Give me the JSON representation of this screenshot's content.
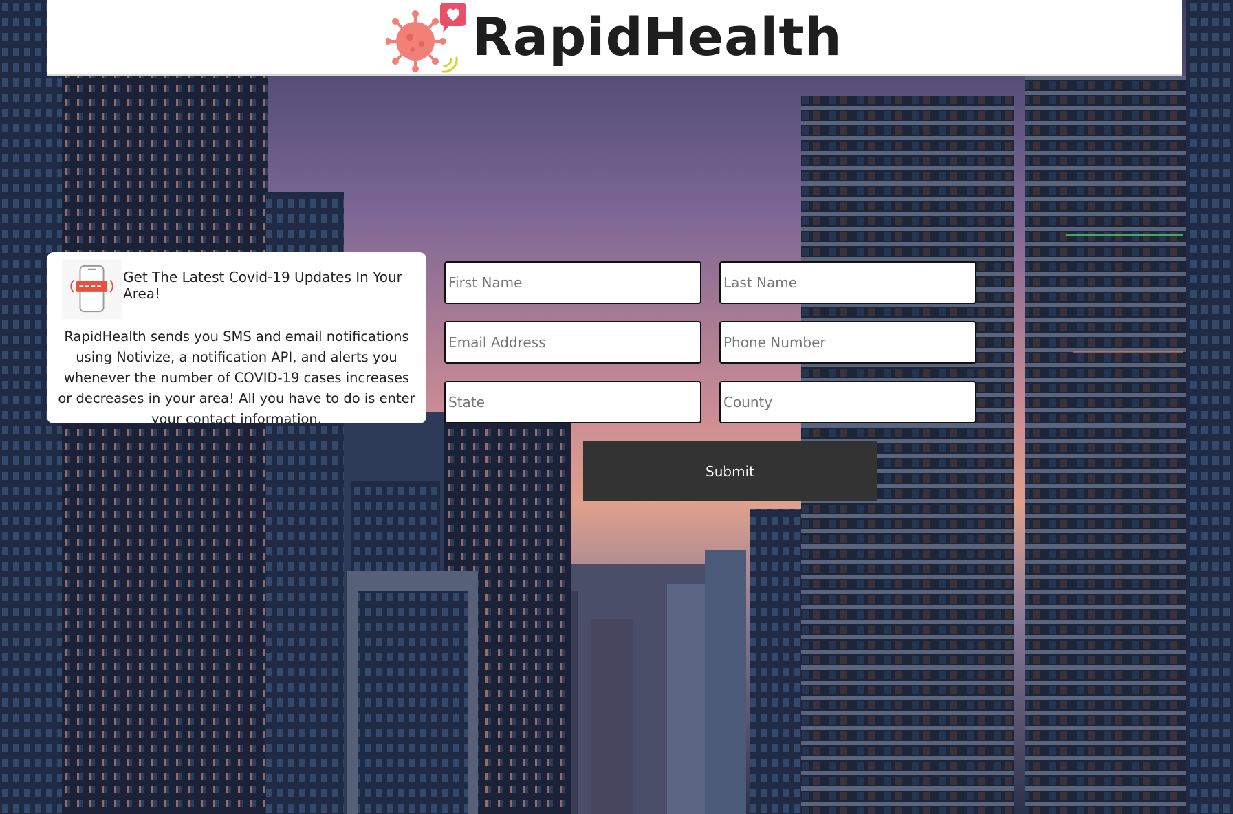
{
  "header": {
    "brand_name": "RapidHealth"
  },
  "info_card": {
    "title": "Get The Latest Covid-19 Updates In Your Area!",
    "description": "RapidHealth sends you SMS and email notifications using Notivize, a notification API, and alerts you whenever the number of COVID-19 cases increases or decreases in your area! All you have to do is enter your contact information."
  },
  "form": {
    "first_name": {
      "placeholder": "First Name",
      "value": ""
    },
    "last_name": {
      "placeholder": "Last Name",
      "value": ""
    },
    "email": {
      "placeholder": "Email Address",
      "value": ""
    },
    "phone": {
      "placeholder": "Phone Number",
      "value": ""
    },
    "state": {
      "placeholder": "State",
      "value": ""
    },
    "county": {
      "placeholder": "County",
      "value": ""
    },
    "submit_label": "Submit"
  },
  "icons": {
    "logo": "virus-notification-logo-icon",
    "info": "phone-alert-icon"
  },
  "colors": {
    "header_bg": "#ffffff",
    "virus": "#f08078",
    "heart_bubble": "#e8506a",
    "signal": "#c8d830",
    "button_bg": "#333333",
    "button_text": "#ffffff"
  }
}
